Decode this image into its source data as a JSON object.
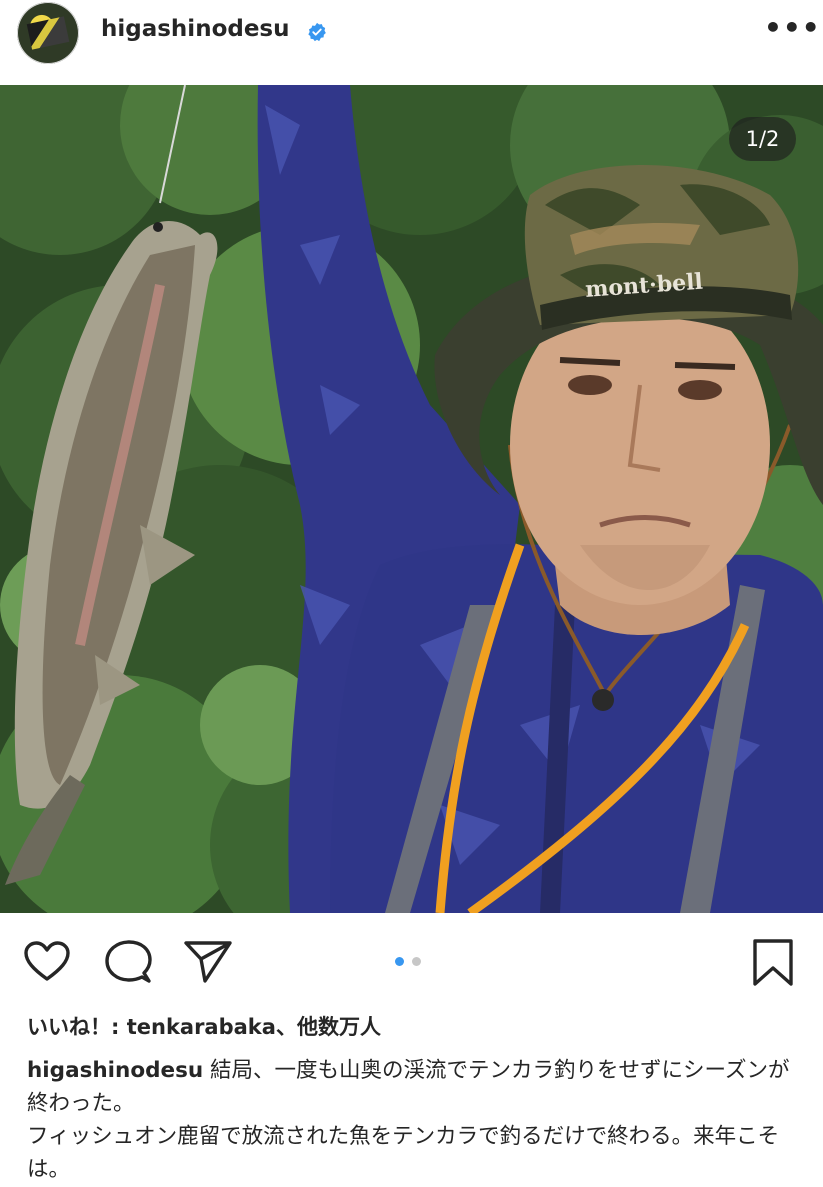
{
  "post": {
    "username": "higashinodesu",
    "verified": true,
    "more_label": "•••",
    "image_counter": "1/2",
    "likes_text": "いいね！: tenkarabaka、他数万人",
    "caption_username": "higashinodesu",
    "caption_line1": " 結局、一度も山奥の渓流でテンカラ釣りをせずにシーズンが終わった。",
    "caption_line2": "フィッシュオン鹿留で放流された魚をテンカラで釣るだけで終わる。来年こそは。",
    "photo_hat_text": "mont·bell"
  },
  "icons": {
    "like": "heart-icon",
    "comment": "comment-icon",
    "share": "send-icon",
    "save": "bookmark-icon",
    "verified": "verified-badge-icon",
    "more": "more-options-icon"
  },
  "carousel": {
    "total": 2,
    "active": 1
  },
  "colors": {
    "accent": "#3897f0",
    "verified": "#3897f0",
    "dot_inactive": "#c7c7c7",
    "text": "#262626"
  }
}
